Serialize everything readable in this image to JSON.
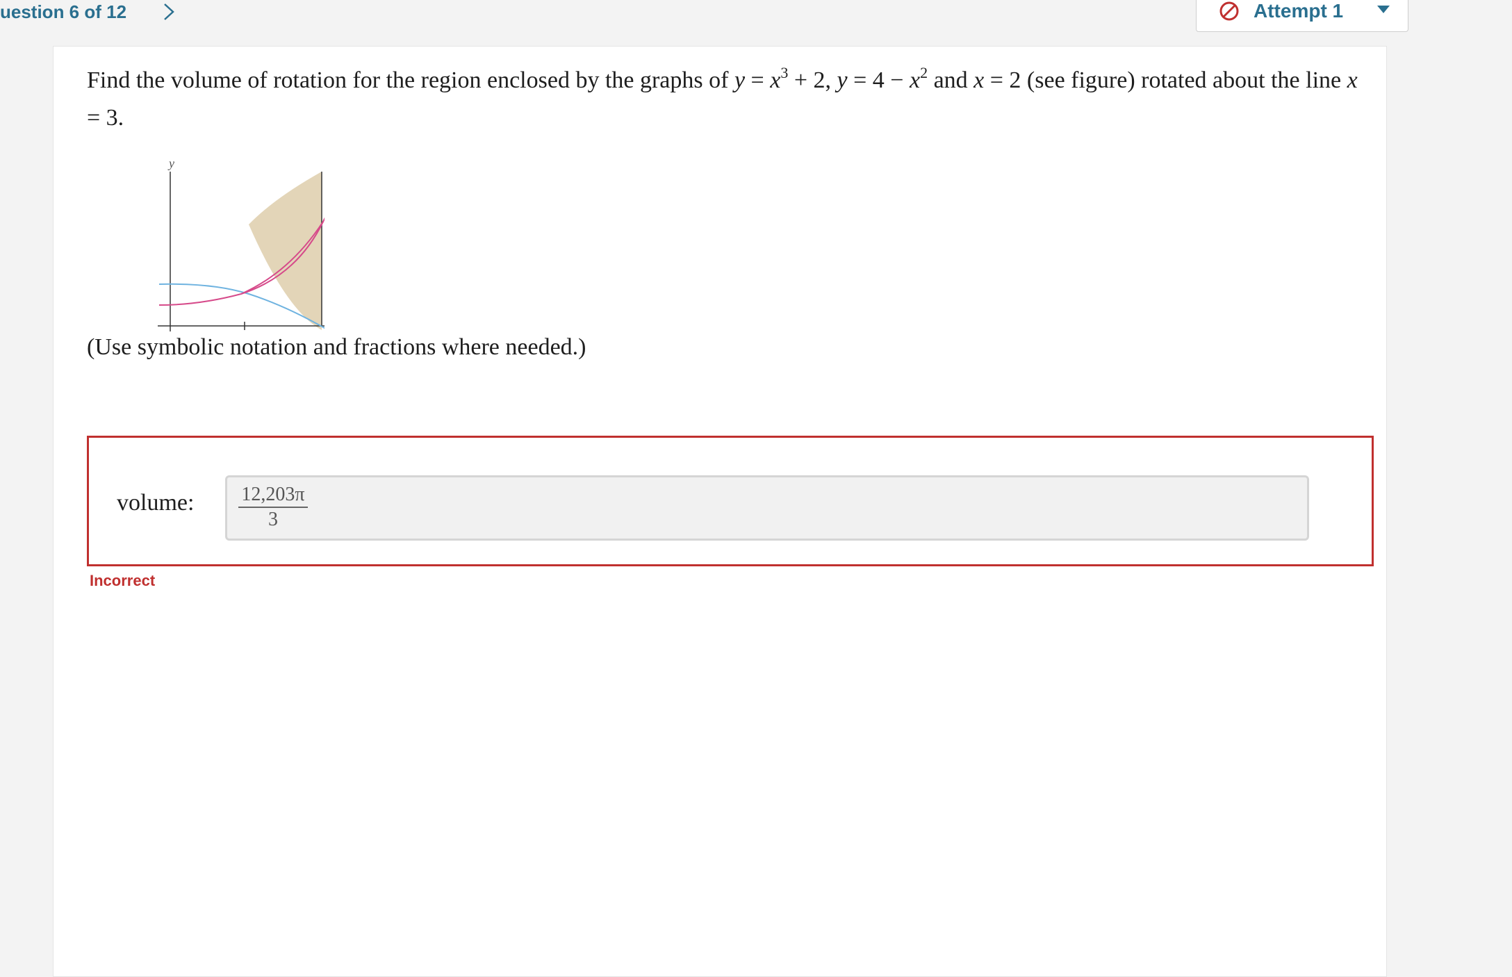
{
  "header": {
    "question_counter": "uestion 6 of 12",
    "next_icon": "chevron-right-icon",
    "attempt_label": "Attempt 1",
    "attempt_icon": "prohibited-circle-icon",
    "dropdown_icon": "caret-down-icon"
  },
  "question": {
    "text_1": "Find the volume of rotation for the region enclosed by the graphs of ",
    "var_y1": "y",
    "eq_1": " = ",
    "var_x1": "x",
    "exp_1": "3",
    "tail_1": " + 2, ",
    "var_y2": "y",
    "eq_2": " = 4 − ",
    "var_x2": "x",
    "exp_2": "2",
    "and": " and ",
    "var_x3": "x",
    "eq_3": " = 2 (see figure) rotated about the line ",
    "var_x4": "x",
    "eq_4": " = 3."
  },
  "figure": {
    "y_axis_label": "y",
    "x_axis_label": "x"
  },
  "hint": "(Use symbolic notation and fractions where needed.)",
  "answer": {
    "label": "volume:",
    "numerator": "12,203π",
    "denominator": "3"
  },
  "feedback": "Incorrect",
  "colors": {
    "accent": "#2a6f8f",
    "error": "#c0302f",
    "curve_cubic": "#d64a8a",
    "curve_parabola": "#6fb3e0",
    "region_fill": "#e3d5b8"
  }
}
